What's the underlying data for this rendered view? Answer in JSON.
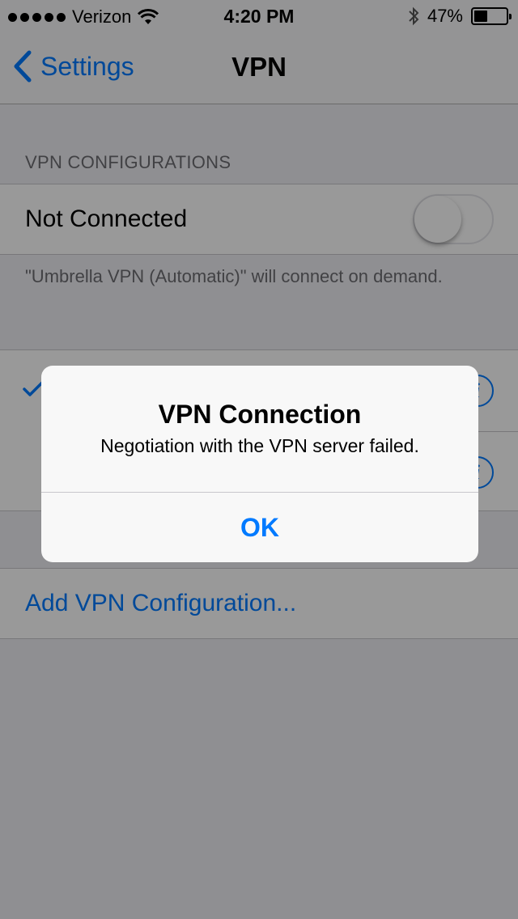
{
  "status_bar": {
    "carrier": "Verizon",
    "time": "4:20 PM",
    "battery_percent": "47%",
    "battery_level": 0.47,
    "icons": [
      "signal-dots",
      "wifi-icon",
      "bluetooth-icon",
      "battery-icon"
    ]
  },
  "nav": {
    "back_label": "Settings",
    "title": "VPN"
  },
  "vpn": {
    "section_header": "VPN CONFIGURATIONS",
    "status_label": "Not Connected",
    "toggle_on": false,
    "footer_note": "\"Umbrella VPN (Automatic)\" will connect on demand.",
    "add_configuration": "Add VPN Configuration..."
  },
  "alert": {
    "title": "VPN Connection",
    "message": "Negotiation with the VPN server failed.",
    "ok_label": "OK"
  },
  "colors": {
    "accent": "#007aff",
    "background": "#efeff4",
    "overlay": "rgba(0,0,0,0.4)"
  }
}
